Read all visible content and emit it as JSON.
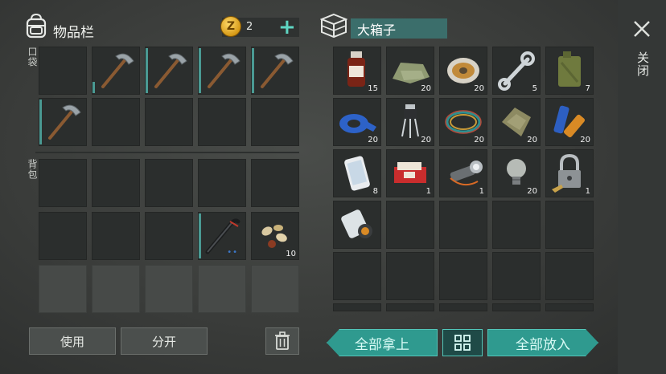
{
  "inventory": {
    "title": "物品栏",
    "coins": "2",
    "pocket_label": "口袋",
    "backpack_label": "背包",
    "pocket_slots": [
      {
        "item": "empty"
      },
      {
        "item": "pickaxe-icon"
      },
      {
        "item": "pickaxe-icon"
      },
      {
        "item": "pickaxe-icon"
      },
      {
        "item": "pickaxe-icon"
      },
      {
        "item": "pickaxe-icon"
      },
      {
        "item": "empty"
      },
      {
        "item": "empty"
      },
      {
        "item": "empty"
      },
      {
        "item": "empty"
      }
    ],
    "backpack_slots": [
      {
        "item": "empty"
      },
      {
        "item": "empty"
      },
      {
        "item": "empty"
      },
      {
        "item": "empty"
      },
      {
        "item": "empty"
      },
      {
        "item": "empty"
      },
      {
        "item": "empty"
      },
      {
        "item": "empty"
      },
      {
        "item": "crowbar-icon"
      },
      {
        "item": "seeds-icon",
        "qty": "10"
      }
    ],
    "use_label": "使用",
    "split_label": "分开"
  },
  "chest": {
    "title": "大箱子",
    "close_label": "关闭",
    "take_all_label": "全部拿上",
    "put_all_label": "全部放入",
    "items": [
      {
        "item": "bottle-icon",
        "qty": "15"
      },
      {
        "item": "cloth-icon",
        "qty": "20"
      },
      {
        "item": "wire-spool-icon",
        "qty": "20"
      },
      {
        "item": "wrench-icon",
        "qty": "5"
      },
      {
        "item": "jerrycan-icon",
        "qty": "7"
      },
      {
        "item": "tape-icon",
        "qty": "20"
      },
      {
        "item": "transistor-icon",
        "qty": "20"
      },
      {
        "item": "wires-icon",
        "qty": "20"
      },
      {
        "item": "rag-icon",
        "qty": "20"
      },
      {
        "item": "batteries-icon",
        "qty": "20"
      },
      {
        "item": "phone-icon",
        "qty": "8"
      },
      {
        "item": "matches-icon",
        "qty": "1"
      },
      {
        "item": "flashlight-icon",
        "qty": "1"
      },
      {
        "item": "lightbulb-icon",
        "qty": "20"
      },
      {
        "item": "padlock-icon",
        "qty": "1"
      },
      {
        "item": "map-icon",
        "qty": ""
      }
    ]
  },
  "colors": {
    "accent": "#2f9a8f",
    "accent_border": "#52c6b9",
    "slot_dark": "#2b2e2d",
    "slot_locked": "#474a48",
    "coin": "#e0a82a"
  }
}
